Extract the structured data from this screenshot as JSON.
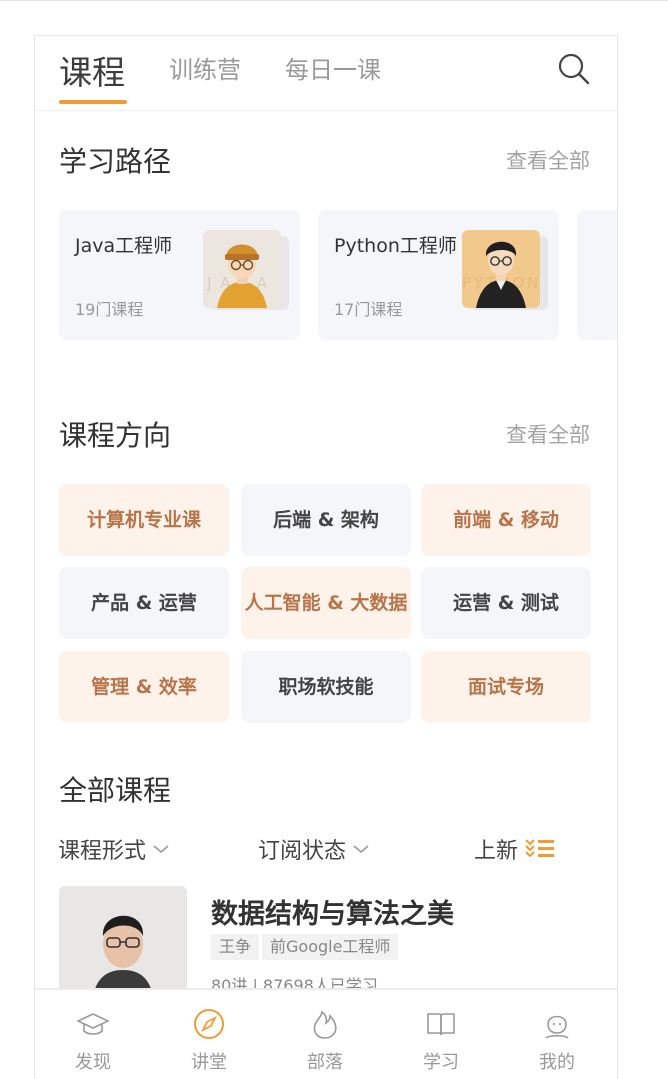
{
  "tabs": {
    "courses": "课程",
    "training": "训练营",
    "daily": "每日一课"
  },
  "paths": {
    "title": "学习路径",
    "see_all": "查看全部",
    "items": [
      {
        "name": "Java工程师",
        "count": "19门课程",
        "watermark": "JAVA"
      },
      {
        "name": "Python工程师",
        "count": "17门课程",
        "watermark": "PYTHON"
      }
    ]
  },
  "directions": {
    "title": "课程方向",
    "see_all": "查看全部",
    "items": [
      {
        "label": "计算机专业课",
        "style": "warm"
      },
      {
        "label": "后端 & 架构",
        "style": "cool"
      },
      {
        "label": "前端 & 移动",
        "style": "warm"
      },
      {
        "label": "产品 & 运营",
        "style": "cool"
      },
      {
        "label": "人工智能 & 大数据",
        "style": "warm"
      },
      {
        "label": "运营 & 测试",
        "style": "cool"
      },
      {
        "label": "管理 & 效率",
        "style": "warm"
      },
      {
        "label": "职场软技能",
        "style": "cool"
      },
      {
        "label": "面试专场",
        "style": "warm"
      }
    ]
  },
  "all_courses": {
    "title": "全部课程",
    "filters": {
      "format": "课程形式",
      "status": "订阅状态",
      "sort": "上新"
    },
    "course": {
      "title": "数据结构与算法之美",
      "author": "王争",
      "author_title": "前Google工程师",
      "meta": "80讲 | 87698人已学习"
    }
  },
  "nav": {
    "discover": "发现",
    "lecture": "讲堂",
    "tribe": "部落",
    "study": "学习",
    "mine": "我的"
  },
  "colors": {
    "accent": "#f09b36",
    "warm_bg": "#fdf3ea",
    "warm_text": "#b8754b",
    "cool_bg": "#f5f6fa"
  }
}
